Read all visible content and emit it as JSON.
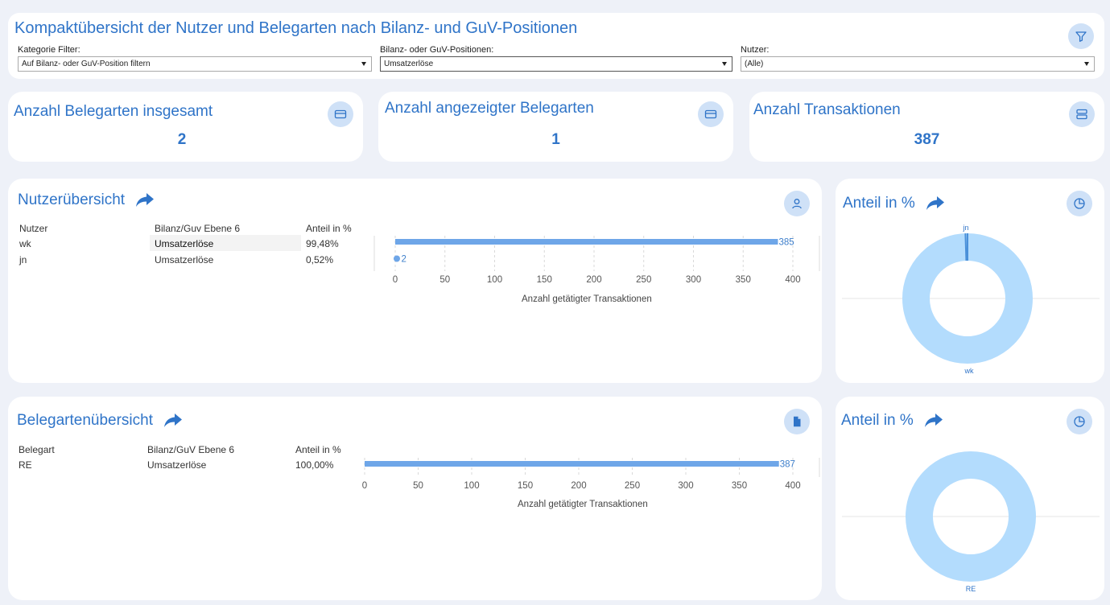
{
  "header": {
    "title": "Kompaktübersicht der Nutzer und Belegarten nach Bilanz- und GuV-Positionen",
    "filters": [
      {
        "label": "Kategorie Filter:",
        "value": "Auf Bilanz- oder GuV-Position filtern"
      },
      {
        "label": "Bilanz- oder GuV-Positionen:",
        "value": "Umsatzerlöse"
      },
      {
        "label": "Nutzer:",
        "value": "(Alle)"
      }
    ],
    "filter_icon": "filter-icon"
  },
  "kpis": [
    {
      "title": "Anzahl Belegarten insgesamt",
      "value": "2",
      "icon": "card-icon"
    },
    {
      "title": "Anzahl angezeigter Belegarten",
      "value": "1",
      "icon": "card-icon"
    },
    {
      "title": "Anzahl Transaktionen",
      "value": "387",
      "icon": "server-icon"
    }
  ],
  "user_panel": {
    "title": "Nutzerübersicht",
    "icon": "user-icon",
    "columns": [
      "Nutzer",
      "Bilanz/Guv Ebene 6",
      "Anteil in %"
    ],
    "rows": [
      {
        "name": "wk",
        "position": "Umsatzerlöse",
        "share": "99,48%"
      },
      {
        "name": "jn",
        "position": "Umsatzerlöse",
        "share": "0,52%"
      }
    ],
    "axis_title": "Anzahl getätigter Transaktionen"
  },
  "user_pie": {
    "title": "Anteil in %",
    "icon": "pie-chart-icon",
    "labels": [
      "jn",
      "wk"
    ]
  },
  "doc_panel": {
    "title": "Belegartenübersicht",
    "icon": "document-icon",
    "columns": [
      "Belegart",
      "Bilanz/GuV Ebene 6",
      "Anteil in %"
    ],
    "rows": [
      {
        "name": "RE",
        "position": "Umsatzerlöse",
        "share": "100,00%"
      }
    ],
    "axis_title": "Anzahl getätigter Transaktionen"
  },
  "doc_pie": {
    "title": "Anteil in %",
    "icon": "pie-chart-icon",
    "labels": [
      "RE"
    ]
  },
  "chart_data": [
    {
      "type": "bar",
      "orientation": "horizontal",
      "categories": [
        "wk",
        "jn"
      ],
      "values": [
        385,
        2
      ],
      "data_labels": [
        "385",
        "2"
      ],
      "xlabel": "Anzahl getätigter Transaktionen",
      "xlim": [
        0,
        400
      ],
      "ticks": [
        "0",
        "50",
        "100",
        "150",
        "200",
        "250",
        "300",
        "350",
        "400"
      ],
      "color": "#6ea6e8"
    },
    {
      "type": "pie",
      "style": "donut",
      "categories": [
        "wk",
        "jn"
      ],
      "values": [
        385,
        2
      ],
      "color": "#b3dcfd",
      "slice_border": "#4a90d9"
    },
    {
      "type": "bar",
      "orientation": "horizontal",
      "categories": [
        "RE"
      ],
      "values": [
        387
      ],
      "data_labels": [
        "387"
      ],
      "xlabel": "Anzahl getätigter Transaktionen",
      "xlim": [
        0,
        400
      ],
      "ticks": [
        "0",
        "50",
        "100",
        "150",
        "200",
        "250",
        "300",
        "350",
        "400"
      ],
      "color": "#6ea6e8"
    },
    {
      "type": "pie",
      "style": "donut",
      "categories": [
        "RE"
      ],
      "values": [
        387
      ],
      "color": "#b3dcfd"
    }
  ]
}
